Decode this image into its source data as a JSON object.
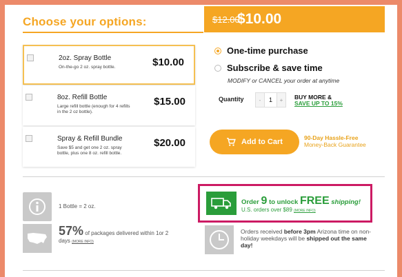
{
  "header": {
    "title": "Choose your options:"
  },
  "price": {
    "old": "$12.00",
    "new": "$10.00"
  },
  "options": [
    {
      "name": "2oz. Spray Bottle",
      "desc": "On-the-go 2 oz. spray bottle.",
      "price": "$10.00",
      "selected": true
    },
    {
      "name": "8oz. Refill Bottle",
      "desc": "Large refill bottle (enough for 4 refills in the 2 oz bottle).",
      "price": "$15.00",
      "selected": false
    },
    {
      "name": "Spray & Refill Bundle",
      "desc": "Save $5 and get one 2 oz. spray bottle, plus one 8 oz. refill bottle.",
      "price": "$20.00",
      "selected": false
    }
  ],
  "purchase": {
    "one_time": "One-time purchase",
    "subscribe": "Subscribe & save time",
    "subscribe_note": "MODIFY or CANCEL your order at anytime"
  },
  "quantity": {
    "label": "Quantity",
    "value": "1",
    "minus": "-",
    "plus": "+",
    "buy_more": "BUY MORE &",
    "save_up": "SAVE UP TO 15%"
  },
  "cart": {
    "button": "Add to Cart",
    "guarantee_1": "90-Day Hassle-Free",
    "guarantee_2": "Money-Back Guarantee"
  },
  "info": {
    "bottle_eq": "1 Bottle = 2 oz.",
    "pct": "57%",
    "pct_text": "of packages delivered within 1or 2",
    "pct_text2": "days",
    "more_info": "(MORE INFO)"
  },
  "shipping": {
    "order": "Order",
    "amount": "9",
    "unlock": "to unlock",
    "free": "FREE",
    "shipping": "shipping!",
    "line2": "U.S. orders over $89",
    "more_info": "(MORE INFO)"
  },
  "cutoff": {
    "t1": "Orders received",
    "before": "before 3pm",
    "t2": "Arizona time on non-holiday weekdays will be",
    "shipped": "shipped out the same day!"
  },
  "colors": {
    "accent": "#f5a623",
    "green": "#2a9d3a",
    "highlight": "#cc1a63",
    "frame": "#ec8a6a"
  }
}
